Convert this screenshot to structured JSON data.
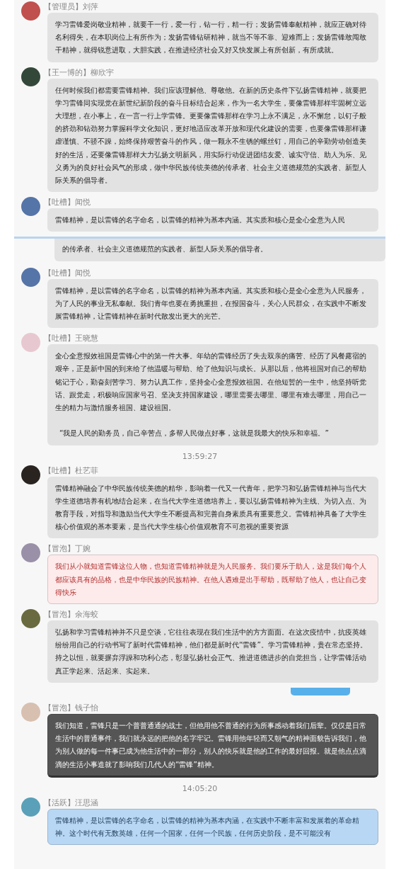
{
  "messages": [
    {
      "kind": "message",
      "sender": "【管理员】刘萍",
      "color": "#e2e2e2",
      "text": "学习雷锋爱岗敬业精神，就要干一行，爱一行，钻一行，精一行；发扬雷锋奉献精神，就应正确对待名利得失，在本职岗位上有所作为；发扬雷锋钻研精神，就当不等不靠、迎难而上；发扬雷锋敢闯敢干精神，就得锐意进取，大胆实践，在推进经济社会又好又快发展上有所创新，有所成就。"
    },
    {
      "kind": "message",
      "sender": "【王一博的】柳欣宇",
      "color": "#e2e2e2",
      "text": "任何时候我们都需要雷锋精神。我们应该理解他、尊敬他。在新的历史条件下弘扬雷锋精神，就要把学习雷锋同实现党在新世纪新阶段的奋斗目标结合起来，作为一名大学生，要像雷锋那样牢固树立远大理想，在小事上，在一言一行上学雷锋。更要像雷锋那样在学习上永不满足，永不懈怠，以钉子般的挤劲和钻劲努力掌握科学文化知识，更好地适应改革开放和现代化建设的需要，也要像雷锋那样谦虚谨慎、不骄不躁，始终保持艰苦奋斗的作风，做一颗永不生锈的螺丝钉，用自己的辛勤劳动创造美好的生活，还要像雷锋那样大力弘扬文明新风，用实际行动促进团结友爱、诚实守信、助人为乐、见义勇为的良好社会风气的形成，做中华民族传统美德的传承者、社会主义道德规范的实践者、新型人际关系的倡导者。"
    },
    {
      "kind": "message",
      "sender": "【吐槽】闻悦",
      "color": "#e2e2e2",
      "text": "雷锋精神，是以雷锋的名字命名，以雷锋的精神为基本内涵。其实质和核心是全心全意为人民"
    },
    {
      "kind": "seam"
    },
    {
      "kind": "fragment",
      "color": "#e2e2e2",
      "text": "的传承者、社会主义道德规范的实践者、新型人际关系的倡导者。"
    },
    {
      "kind": "message",
      "sender": "【吐槽】闻悦",
      "color": "#e2e2e2",
      "text": "雷锋精神，是以雷锋的名字命名，以雷锋的精神为基本内涵。其实质和核心是全心全意为人民服务，为了人民的事业无私奉献。我们青年也要在勇挑重担，在报国奋斗，关心人民群众，在实践中不断发展雷锋精神，让雷锋精神在新时代散发出更大的光芒。"
    },
    {
      "kind": "message",
      "sender": "【吐槽】王晓慧",
      "color": "#e2e2e2",
      "text": "全心全意报效祖国是雷锋心中的第一件大事。年幼的雷锋经历了失去双亲的痛苦、经历了风餐露宿的艰辛，正是新中国的到来给了他温暖与帮助、给了他知识与成长。从那以后，他将祖国对自己的帮助铭记于心，勤奋刻苦学习、努力认真工作，坚持全心全意报效祖国。在他短暂的一生中，他坚持听党话、跟党走，积极响应国家号召、坚决支持国家建设，哪里需要去哪里、哪里有难去哪里，用自己一生的精力与激情服务祖国、建设祖国。",
      "quote": "“我是人民的勤务员，自己辛苦点，多帮人民做点好事，这就是我最大的快乐和幸福。”"
    },
    {
      "kind": "time",
      "text": "13:59:27"
    },
    {
      "kind": "message",
      "sender": "【吐槽】杜艺菲",
      "color": "#e2e2e2",
      "text": "雷锋精神融会了中华民族传统美德的精华，影响着一代又一代青年，把学习和弘扬雷锋精神与当代大学生道德培养有机地结合起来，在当代大学生道德培养上，要以弘扬雷锋精神为主线、为切入点、为教育手段，对指导和激励当代大学生不断提高和完善自身素质具有重要意义。雷锋精神具备了大学生核心价值观的基本要素，是当代大学生核心价值观教育不可忽视的重要资源"
    },
    {
      "kind": "message",
      "sender": "【冒泡】丁婉",
      "color": "#fdeaea",
      "text": "我们从小就知道雷锋这位人物，也知道雷锋精神就是为人民服务。我们要乐于助人，这是我们每个人都应该具有的品格，也是中华民族的民族精神。在他人遇难是出手帮助，既帮助了他人，也让自己变得快乐"
    },
    {
      "kind": "message",
      "sender": "【冒泡】余海蛟",
      "color": "#e2e2e2",
      "text": "弘扬和学习雷锋精神并不只是空谈，它往往表现在我们生活中的方方面面。在这次疫情中，抗疫英雄纷纷用自己的行动书写了新时代雷锋精神，他们都是新时代“雷锋”。学习雷锋精神，贵在常态坚持。持之以恒，就要摒弃浮躁和功利心态，彰显弘扬社会正气、推进道德进步的自觉担当，让学雷锋活动真正学起来、活起来、实起来。"
    },
    {
      "kind": "own_partial"
    },
    {
      "kind": "message",
      "sender": "【冒泡】钱子怡",
      "color": "#555555",
      "text": "我们知道，雷锋只是一个普普通通的战士，但他用他不普通的行为所事感动着我们后辈。仅仅是日常生活中的普通事件，我们就永远的把他的名字牢记。雷锋用他年轻而又朝气的精神面貌告诉我们，他为别人做的每一件事已成为他生活中的一部分，别人的快乐就是他的工作的最好回报。就是他点点滴滴的生活小事造就了影响我们几代人的“雷锋”精神。"
    },
    {
      "kind": "time",
      "text": "14:05:20"
    },
    {
      "kind": "message",
      "sender": "【活跃】汪思涵",
      "color": "#b8d7f4",
      "text": "雷锋精神，是以雷锋的名字命名，以雷锋的精神为基本内涵，在实践中不断丰富和发展着的革命精神。这个时代有无数英雄，任何一个国家，任何一个民族，任何历史阶段，是不可能没有"
    }
  ]
}
